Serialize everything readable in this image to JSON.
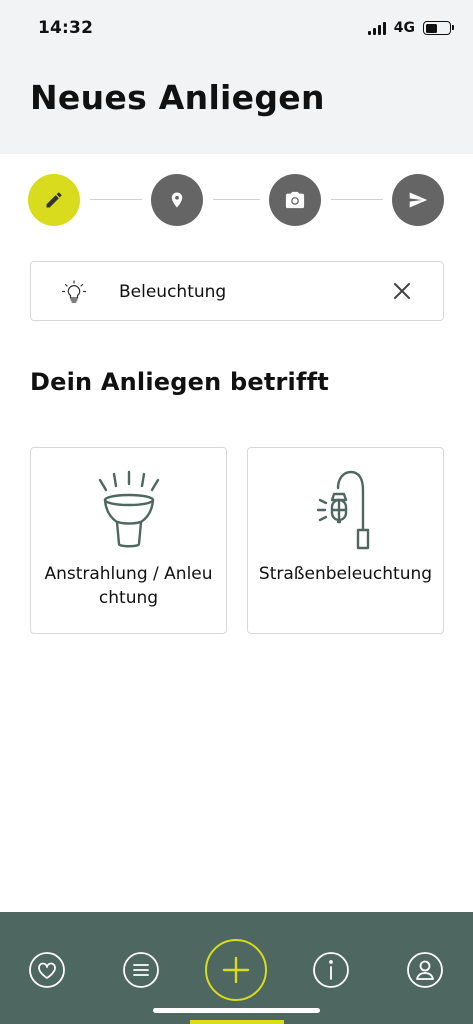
{
  "status_bar": {
    "time": "14:32",
    "network": "4G"
  },
  "header": {
    "title": "Neues Anliegen"
  },
  "stepper": {
    "steps": [
      {
        "name": "edit",
        "icon": "pencil-icon",
        "active": true
      },
      {
        "name": "location",
        "icon": "location-pin-icon",
        "active": false
      },
      {
        "name": "photo",
        "icon": "camera-icon",
        "active": false
      },
      {
        "name": "send",
        "icon": "send-icon",
        "active": false
      }
    ],
    "colors": {
      "active": "#d8dc1c",
      "inactive": "#656565"
    }
  },
  "category_chip": {
    "label": "Beleuchtung",
    "icon": "lightbulb-icon",
    "close_icon": "close-icon"
  },
  "section": {
    "title": "Dein Anliegen betrifft"
  },
  "options": [
    {
      "label": "Anstrahlung / Anleuchtung",
      "icon": "spotlight-icon"
    },
    {
      "label": "Straßenbeleuchtung",
      "icon": "street-lamp-icon"
    }
  ],
  "tab_bar": {
    "tabs": [
      {
        "name": "favorites",
        "icon": "heart-icon"
      },
      {
        "name": "list",
        "icon": "list-icon"
      },
      {
        "name": "new",
        "icon": "plus-icon",
        "active": true
      },
      {
        "name": "info",
        "icon": "info-icon"
      },
      {
        "name": "profile",
        "icon": "user-icon"
      }
    ],
    "colors": {
      "background": "#4e6760",
      "accent": "#d8dc1c"
    }
  }
}
